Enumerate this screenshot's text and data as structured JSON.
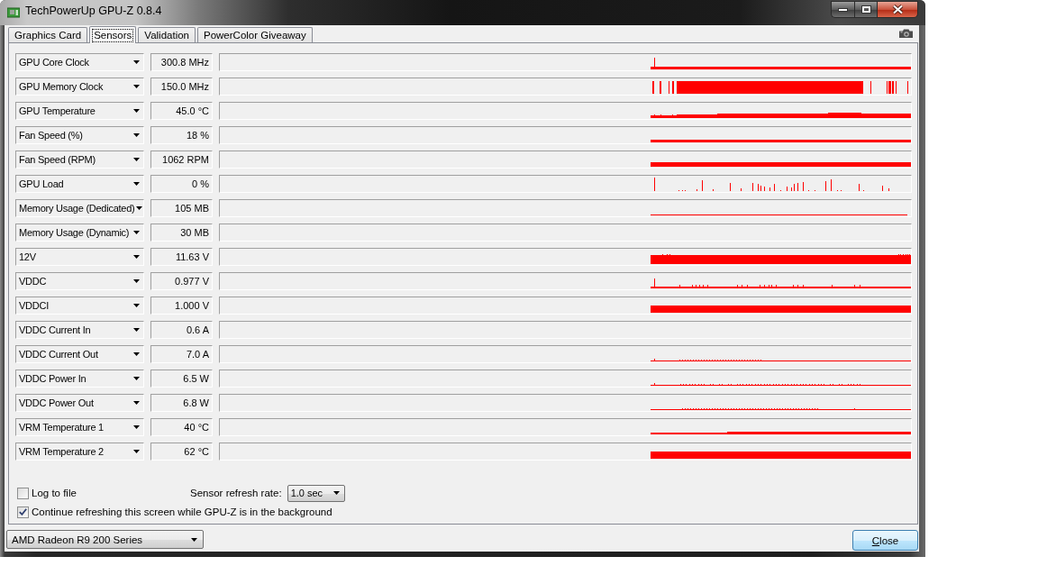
{
  "window": {
    "title": "TechPowerUp GPU-Z 0.8.4"
  },
  "tabs": [
    {
      "label": "Graphics Card",
      "selected": false
    },
    {
      "label": "Sensors",
      "selected": true
    },
    {
      "label": "Validation",
      "selected": false
    },
    {
      "label": "PowerColor Giveaway",
      "selected": false
    }
  ],
  "sensors": [
    {
      "name": "GPU Core Clock",
      "value": "300.8 MHz"
    },
    {
      "name": "GPU Memory Clock",
      "value": "150.0 MHz"
    },
    {
      "name": "GPU Temperature",
      "value": "45.0 °C"
    },
    {
      "name": "Fan Speed (%)",
      "value": "18 %"
    },
    {
      "name": "Fan Speed (RPM)",
      "value": "1062 RPM"
    },
    {
      "name": "GPU Load",
      "value": "0 %"
    },
    {
      "name": "Memory Usage (Dedicated)",
      "value": "105 MB"
    },
    {
      "name": "Memory Usage (Dynamic)",
      "value": "30 MB"
    },
    {
      "name": "12V",
      "value": "11.63 V"
    },
    {
      "name": "VDDC",
      "value": "0.977 V"
    },
    {
      "name": "VDDCI",
      "value": "1.000 V"
    },
    {
      "name": "VDDC Current In",
      "value": "0.6 A"
    },
    {
      "name": "VDDC Current Out",
      "value": "7.0 A"
    },
    {
      "name": "VDDC Power In",
      "value": "6.5 W"
    },
    {
      "name": "VDDC Power Out",
      "value": "6.8 W"
    },
    {
      "name": "VRM Temperature 1",
      "value": "40 °C"
    },
    {
      "name": "VRM Temperature 2",
      "value": "62 °C"
    }
  ],
  "log_option": {
    "label": "Log to file",
    "checked": false
  },
  "refresh_rate": {
    "label": "Sensor refresh rate:",
    "value": "1.0 sec"
  },
  "background_option": {
    "label": "Continue refreshing this screen while GPU-Z is in the background",
    "checked": true
  },
  "gpu_select": {
    "value": "AMD Radeon R9 200 Series"
  },
  "buttons": [
    {
      "label": "Close"
    }
  ]
}
